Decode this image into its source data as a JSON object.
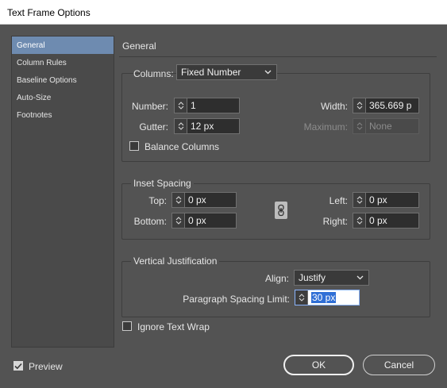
{
  "window": {
    "title": "Text Frame Options"
  },
  "sidebar": {
    "items": [
      {
        "label": "General",
        "selected": true
      },
      {
        "label": "Column Rules",
        "selected": false
      },
      {
        "label": "Baseline Options",
        "selected": false
      },
      {
        "label": "Auto-Size",
        "selected": false
      },
      {
        "label": "Footnotes",
        "selected": false
      }
    ]
  },
  "main": {
    "section_title": "General",
    "columns": {
      "label": "Columns:",
      "type_value": "Fixed Number",
      "number_label": "Number:",
      "number_value": "1",
      "gutter_label": "Gutter:",
      "gutter_value": "12 px",
      "width_label": "Width:",
      "width_value": "365.669 p",
      "maximum_label": "Maximum:",
      "maximum_value": "None",
      "balance_label": "Balance Columns",
      "balance_checked": false
    },
    "inset_spacing": {
      "title": "Inset Spacing",
      "top_label": "Top:",
      "top_value": "0 px",
      "bottom_label": "Bottom:",
      "bottom_value": "0 px",
      "left_label": "Left:",
      "left_value": "0 px",
      "right_label": "Right:",
      "right_value": "0 px"
    },
    "vertical_justification": {
      "title": "Vertical Justification",
      "align_label": "Align:",
      "align_value": "Justify",
      "spacing_limit_label": "Paragraph Spacing Limit:",
      "spacing_limit_value": "30 px"
    },
    "ignore_wrap": {
      "label": "Ignore Text Wrap",
      "checked": false
    }
  },
  "footer": {
    "preview_label": "Preview",
    "preview_checked": true,
    "ok_label": "OK",
    "cancel_label": "Cancel"
  },
  "colors": {
    "dialog_bg": "#535353",
    "selected_item": "#6e8bb0",
    "field_bg": "#2e2e2e"
  }
}
